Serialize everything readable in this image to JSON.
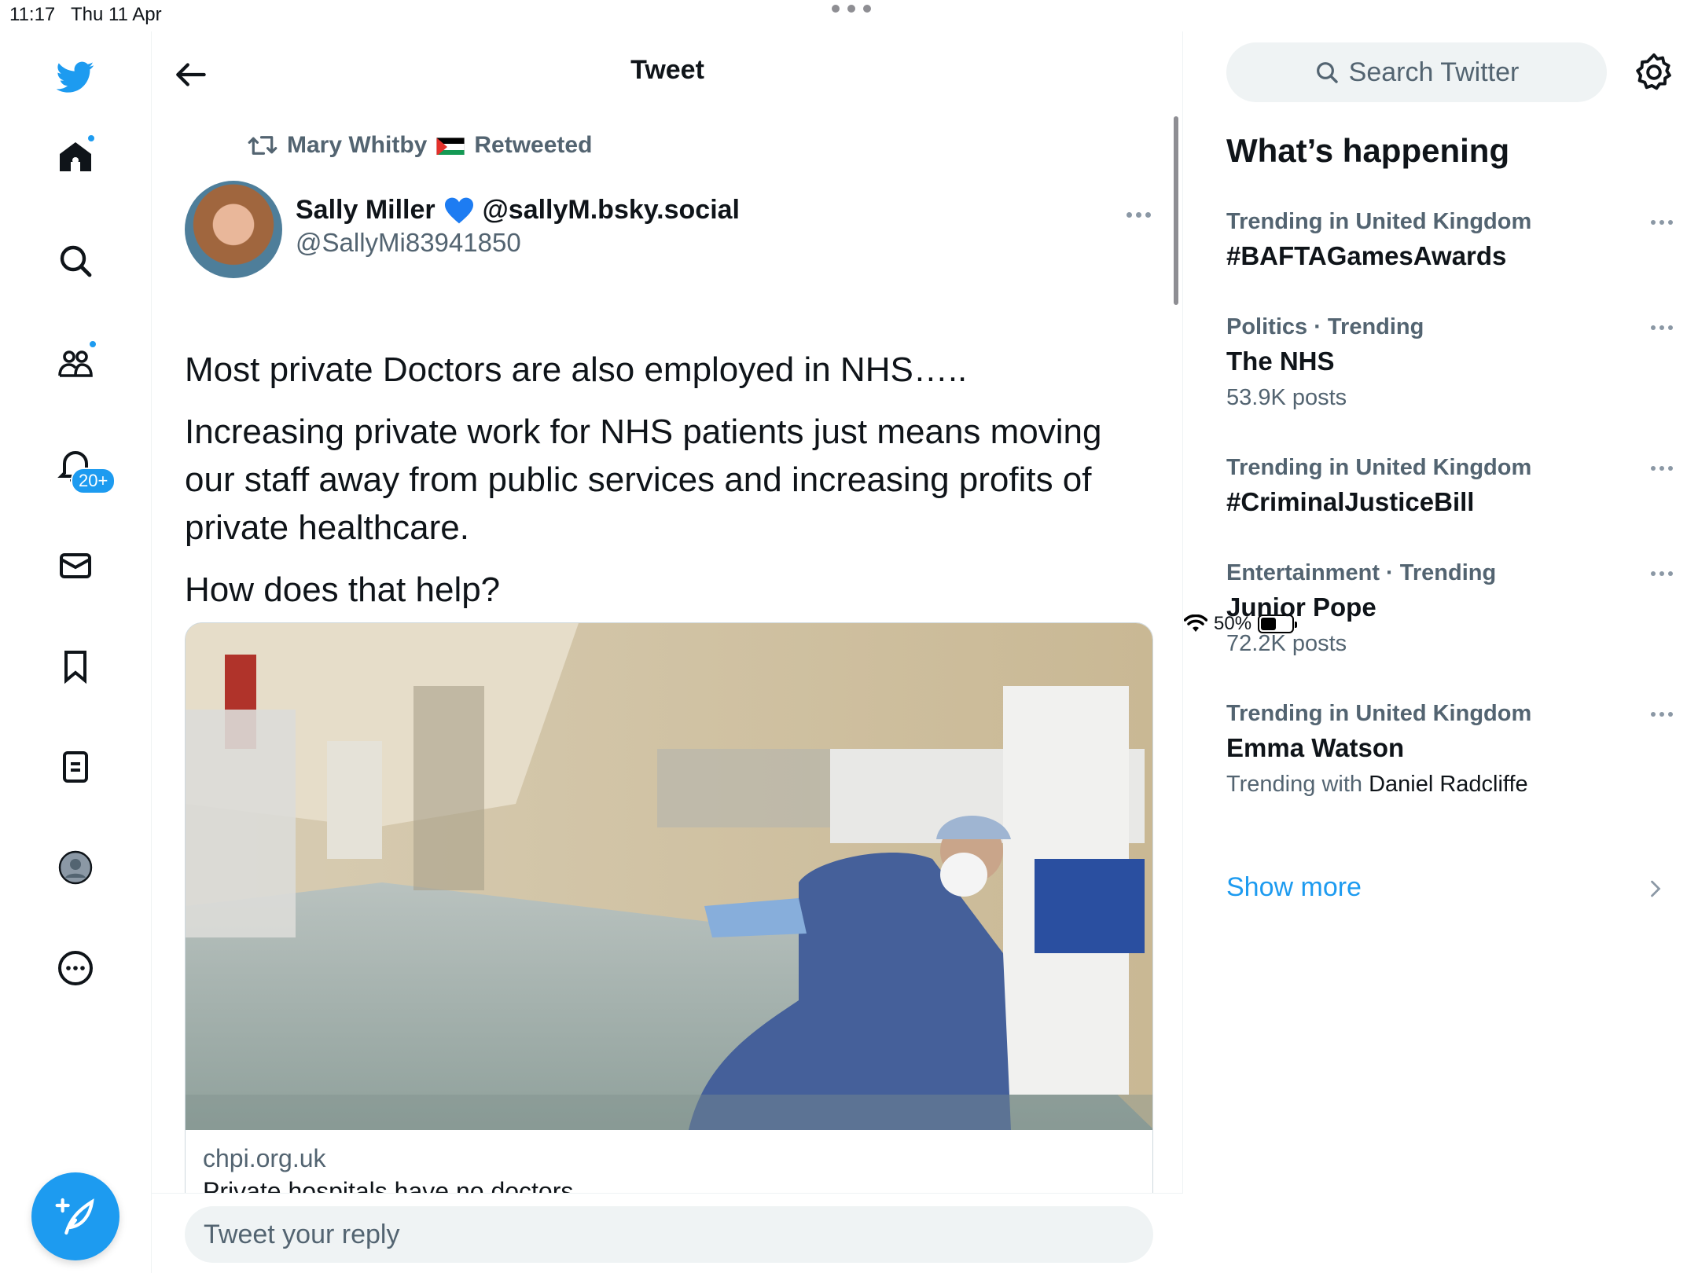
{
  "status": {
    "time": "11:17",
    "date": "Thu 11 Apr",
    "battery": "50%",
    "battery_level": 0.5
  },
  "nav": {
    "notifications_badge": "20+",
    "items": [
      "twitter-logo",
      "home-icon",
      "search-icon",
      "communities-icon",
      "notifications-icon",
      "messages-icon",
      "bookmarks-icon",
      "lists-icon",
      "profile-icon",
      "more-icon"
    ]
  },
  "header": {
    "title": "Tweet"
  },
  "tweet": {
    "retweeted_by": "Mary Whitby",
    "retweeted_label": "Retweeted",
    "author_name": "Sally Miller",
    "author_alt": "@sallyM.bsky.social",
    "handle": "@SallyMi83941850",
    "paragraphs": [
      "Most private Doctors are also employed in  NHS…..",
      "Increasing private work for NHS patients just means moving our staff away from public services and increasing profits of private healthcare.",
      "How does that help?"
    ],
    "card": {
      "domain": "chpi.org.uk",
      "title": "Private hospitals have no doctors"
    }
  },
  "reply": {
    "placeholder": "Tweet your reply"
  },
  "sidebar": {
    "search_placeholder": "Search Twitter",
    "heading": "What’s happening",
    "trends": [
      {
        "context": "Trending in United Kingdom",
        "title": "#BAFTAGamesAwards",
        "sub": ""
      },
      {
        "context": "Politics · Trending",
        "title": "The NHS",
        "sub": "53.9K posts"
      },
      {
        "context": "Trending in United Kingdom",
        "title": "#CriminalJusticeBill",
        "sub": ""
      },
      {
        "context": "Entertainment · Trending",
        "title": "Junior Pope",
        "sub": "72.2K posts"
      },
      {
        "context": "Trending in United Kingdom",
        "title": "Emma Watson",
        "sub_prefix": "Trending with",
        "sub_name": "Daniel Radcliffe"
      }
    ],
    "show_more": "Show more"
  },
  "colors": {
    "accent": "#1d9bf0",
    "text": "#0f1419",
    "secondary": "#536471"
  }
}
